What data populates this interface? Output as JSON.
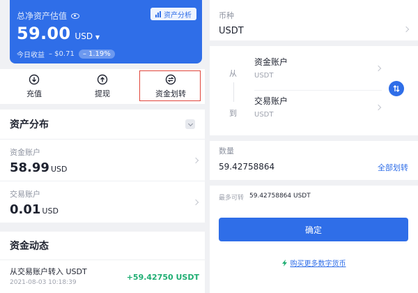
{
  "left": {
    "balance": {
      "label": "总净资产估值",
      "value": "59.00",
      "unit": "USD",
      "analysis_label": "资产分析",
      "income_label": "今日收益",
      "income_value": "– $0.71",
      "income_percent": "– 1.19%"
    },
    "actions": [
      {
        "label": "充值",
        "icon": "deposit-icon"
      },
      {
        "label": "提现",
        "icon": "withdraw-icon"
      },
      {
        "label": "资金划转",
        "icon": "transfer-icon"
      }
    ],
    "distribution": {
      "title": "资产分布",
      "accounts": [
        {
          "name": "资金账户",
          "value": "58.99",
          "unit": "USD"
        },
        {
          "name": "交易账户",
          "value": "0.01",
          "unit": "USD"
        }
      ]
    },
    "activity": {
      "title": "资金动态",
      "records": [
        {
          "title": "从交易账户转入 USDT",
          "time": "2021-08-03 10:18:39",
          "amount": "+59.42750 USDT"
        }
      ]
    }
  },
  "right": {
    "coin_label": "币种",
    "coin_value": "USDT",
    "from_label": "从",
    "to_label": "到",
    "from_account": {
      "name": "资金账户",
      "unit": "USDT"
    },
    "to_account": {
      "name": "交易账户",
      "unit": "USDT"
    },
    "amount_label": "数量",
    "amount_value": "59.42758864",
    "all_transfer_label": "全部划转",
    "max_label": "最多可转",
    "max_value": "59.42758864 USDT",
    "confirm_label": "确定",
    "buy_link": "购买更多数字货币"
  },
  "colors": {
    "accent": "#2f6ee8",
    "positive": "#1fae73",
    "highlight_border": "#e0443a"
  }
}
